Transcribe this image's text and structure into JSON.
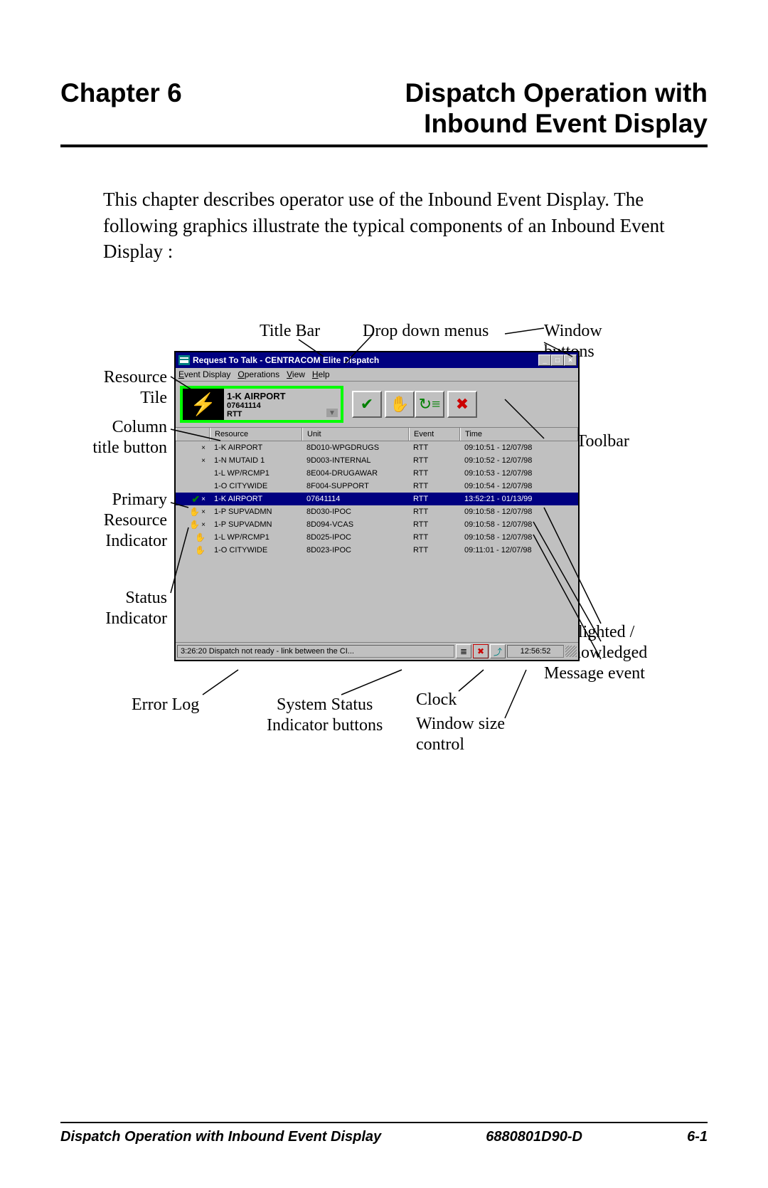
{
  "header": {
    "chapter": "Chapter 6",
    "title_l1": "Dispatch Operation with",
    "title_l2": "Inbound Event Display"
  },
  "intro": "This chapter describes operator use of the Inbound Event Display.  The following graphics illustrate the typical components of an Inbound Event Display :",
  "callouts": {
    "title_bar": "Title Bar",
    "dropdown": "Drop down menus",
    "window_btns_l1": "Window",
    "window_btns_l2": "buttons",
    "resource_tile_l1": "Resource",
    "resource_tile_l2": "Tile",
    "col_title_l1": "Column",
    "col_title_l2": "title button",
    "ied_toolbar": "IED Toolbar",
    "primary_l1": "Primary",
    "primary_l2": "Resource",
    "primary_l3": "Indicator",
    "status_l1": "Status",
    "status_l2": "Indicator",
    "highlighted_l1": "Highlighted /",
    "highlighted_l2": "Acknowledged",
    "highlighted_l3": "Message event",
    "error_log": "Error Log",
    "sys_status_l1": "System Status",
    "sys_status_l2": "Indicator buttons",
    "clock": "Clock",
    "winsize_l1": "Window size",
    "winsize_l2": "control"
  },
  "app": {
    "title": "Request To Talk - CENTRACOM Elite Dispatch",
    "menus": {
      "event": "Event Display",
      "ops": "Operations",
      "view": "View",
      "help": "Help"
    },
    "tile": {
      "name": "1-K AIRPORT",
      "id": "07641114",
      "status": "RTT"
    },
    "columns": {
      "resource": "Resource",
      "unit": "Unit",
      "event": "Event",
      "time": "Time"
    },
    "rows": [
      {
        "statusIcons": [
          "x"
        ],
        "resource": "1-K AIRPORT",
        "unit": "8D010-WPGDRUGS",
        "event": "RTT",
        "time": "09:10:51 - 12/07/98",
        "hl": false
      },
      {
        "statusIcons": [
          "x"
        ],
        "resource": "1-N MUTAID 1",
        "unit": "9D003-INTERNAL",
        "event": "RTT",
        "time": "09:10:52 - 12/07/98",
        "hl": false
      },
      {
        "statusIcons": [],
        "resource": "1-L WP/RCMP1",
        "unit": "8E004-DRUGAWAR",
        "event": "RTT",
        "time": "09:10:53 - 12/07/98",
        "hl": false
      },
      {
        "statusIcons": [],
        "resource": "1-O CITYWIDE",
        "unit": "8F004-SUPPORT",
        "event": "RTT",
        "time": "09:10:54 - 12/07/98",
        "hl": false
      },
      {
        "statusIcons": [
          "check",
          "x"
        ],
        "resource": "1-K AIRPORT",
        "unit": "07641114",
        "event": "RTT",
        "time": "13:52:21 - 01/13/99",
        "hl": true
      },
      {
        "statusIcons": [
          "hand",
          "x"
        ],
        "resource": "1-P SUPVADMN",
        "unit": "8D030-IPOC",
        "event": "RTT",
        "time": "09:10:58 - 12/07/98",
        "hl": false
      },
      {
        "statusIcons": [
          "hand",
          "x"
        ],
        "resource": "1-P SUPVADMN",
        "unit": "8D094-VCAS",
        "event": "RTT",
        "time": "09:10:58 - 12/07/98",
        "hl": false
      },
      {
        "statusIcons": [
          "hand"
        ],
        "resource": "1-L WP/RCMP1",
        "unit": "8D025-IPOC",
        "event": "RTT",
        "time": "09:10:58 - 12/07/98",
        "hl": false
      },
      {
        "statusIcons": [
          "hand"
        ],
        "resource": "1-O CITYWIDE",
        "unit": "8D023-IPOC",
        "event": "RTT",
        "time": "09:11:01 - 12/07/98",
        "hl": false
      }
    ],
    "statusbar": {
      "msg": "3:26:20  Dispatch not ready - link between the CI...",
      "clock": "12:56:52"
    }
  },
  "footer": {
    "left": "Dispatch Operation with Inbound Event Display",
    "mid": "6880801D90-D",
    "right": "6-1"
  }
}
